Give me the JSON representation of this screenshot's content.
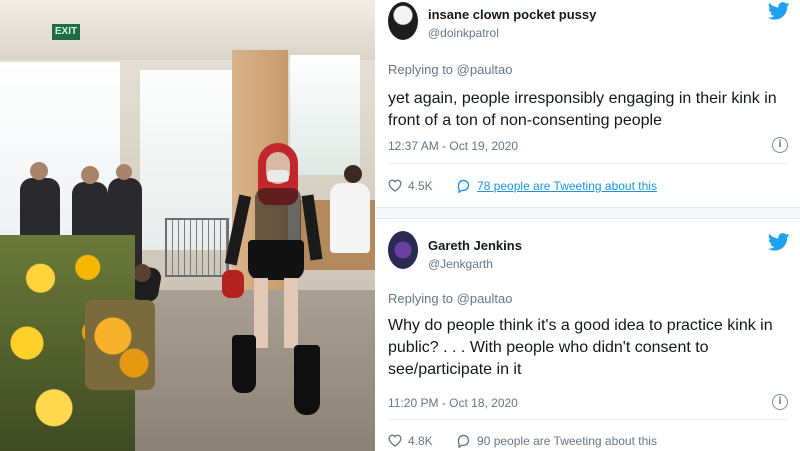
{
  "photo": {
    "exit_sign": "EXIT"
  },
  "tweets": [
    {
      "display_name": "insane clown pocket pussy",
      "handle": "@doinkpatrol",
      "replying_to": "Replying to @paultao",
      "text": "yet again, people irresponsibly engaging in their kink in front of a ton of non-consenting people",
      "timestamp": "12:37 AM - Oct 19, 2020",
      "likes": "4.5K",
      "discussion": "78 people are Tweeting about this"
    },
    {
      "display_name": "Gareth Jenkins",
      "handle": "@Jenkgarth",
      "replying_to": "Replying to @paultao",
      "text": "Why do people think it's a good idea to practice kink in public? . . . With people who didn't consent to see/participate in it",
      "timestamp": "11:20 PM - Oct 18, 2020",
      "likes": "4.8K",
      "discussion": "90 people are Tweeting about this"
    }
  ],
  "colors": {
    "twitter_blue": "#1da1f2",
    "link_blue": "#1b95e0",
    "like_heart": "#e0245e",
    "secondary_text": "#657786"
  },
  "icons": [
    "twitter-bird-icon",
    "info-icon",
    "heart-icon",
    "reply-bubble-icon"
  ]
}
